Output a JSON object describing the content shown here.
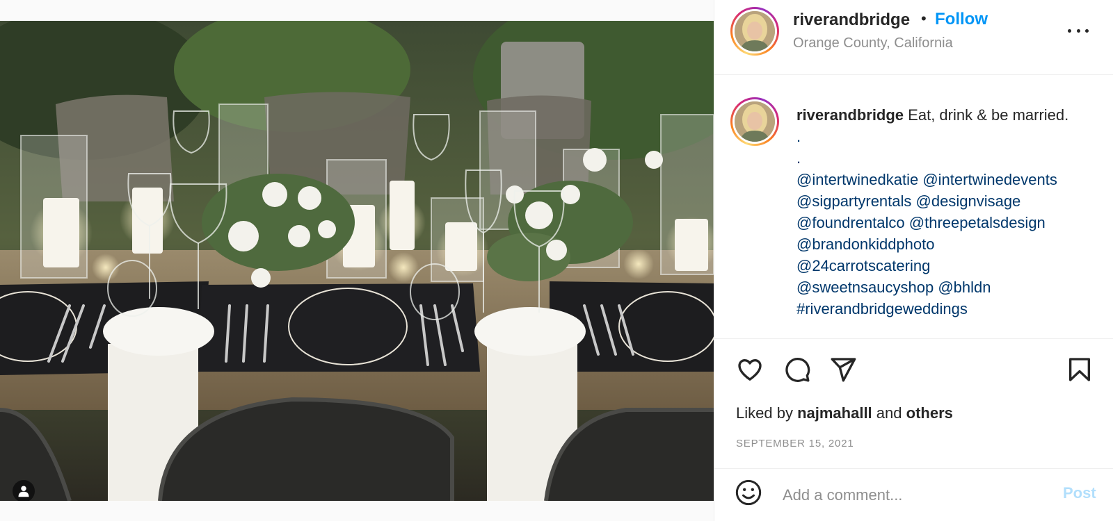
{
  "post": {
    "image_alt": "Outdoor wedding reception table with candles, white florals, glassware and black printed menus",
    "tag_icon": "person-tag-icon"
  },
  "header": {
    "username": "riverandbridge",
    "separator": "•",
    "follow_label": "Follow",
    "location": "Orange County, California",
    "more_icon": "more-options-icon"
  },
  "caption": {
    "username": "riverandbridge",
    "text": "Eat, drink & be married.",
    "dots": [
      ".",
      "."
    ],
    "mentions": [
      [
        "@intertwinedkatie",
        "@intertwinedevents"
      ],
      [
        "@sigpartyrentals",
        "@designvisage"
      ],
      [
        "@foundrentalco",
        "@threepetalsdesign"
      ],
      [
        "@brandonkiddphoto"
      ],
      [
        "@24carrotscatering"
      ],
      [
        "@sweetnsaucyshop",
        "@bhldn"
      ],
      [
        "#riverandbridgeweddings"
      ]
    ]
  },
  "actions": {
    "icons": [
      "heart-icon",
      "comment-icon",
      "share-icon",
      "bookmark-icon"
    ],
    "liked_by_prefix": "Liked by",
    "liked_by_user": "najmahalll",
    "liked_by_and": "and",
    "liked_by_others": "others",
    "date": "SEPTEMBER 15, 2021"
  },
  "comment": {
    "placeholder": "Add a comment...",
    "post_label": "Post",
    "emoji_icon": "emoji-icon"
  },
  "colors": {
    "link_blue": "#0095f6",
    "mention_navy": "#00376b",
    "muted_gray": "#8e8e8e",
    "post_disabled": "#b2dffc"
  }
}
